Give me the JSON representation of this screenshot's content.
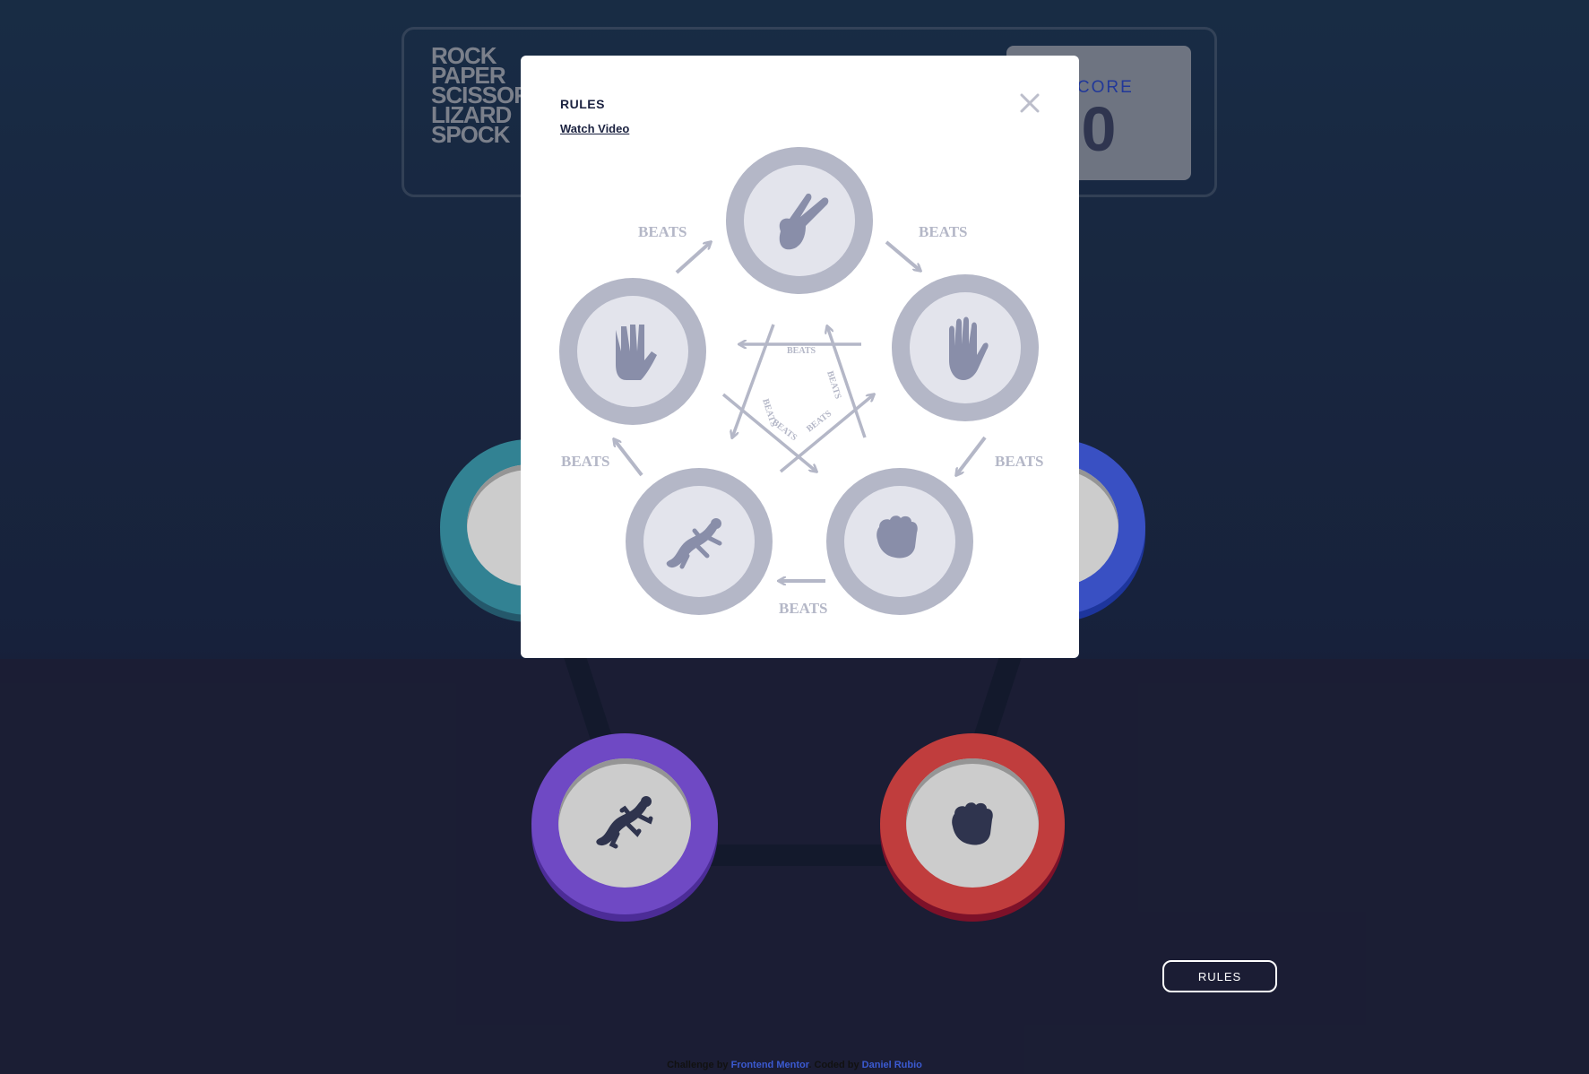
{
  "header": {
    "logo_lines": [
      "ROCK",
      "PAPER",
      "SCISSORS",
      "LIZARD",
      "SPOCK"
    ],
    "score_label": "SCORE",
    "score_value": "0"
  },
  "rules_button_label": "RULES",
  "footer": {
    "challenge_prefix": "Challenge by ",
    "challenge_link": "Frontend Mentor",
    "coded_prefix": ". Coded by ",
    "coded_link": "Daniel Rubio"
  },
  "modal": {
    "title": "RULES",
    "watch_video_label": "Watch Video",
    "beats_label": "BEATS",
    "close_icon": "close-icon"
  },
  "chips": {
    "lizard": "lizard-icon",
    "rock": "rock-icon",
    "spock": "spock-icon",
    "paper": "paper-icon",
    "scissors": "scissors-icon"
  },
  "colors": {
    "background": "#1f3756",
    "score_label": "#2a46c0",
    "lizard": "#8b5cf6",
    "rock": "#f04d4d",
    "spock": "#3fa3b8",
    "paper": "#4865f4",
    "modal_gray": "#b4b7c7"
  }
}
